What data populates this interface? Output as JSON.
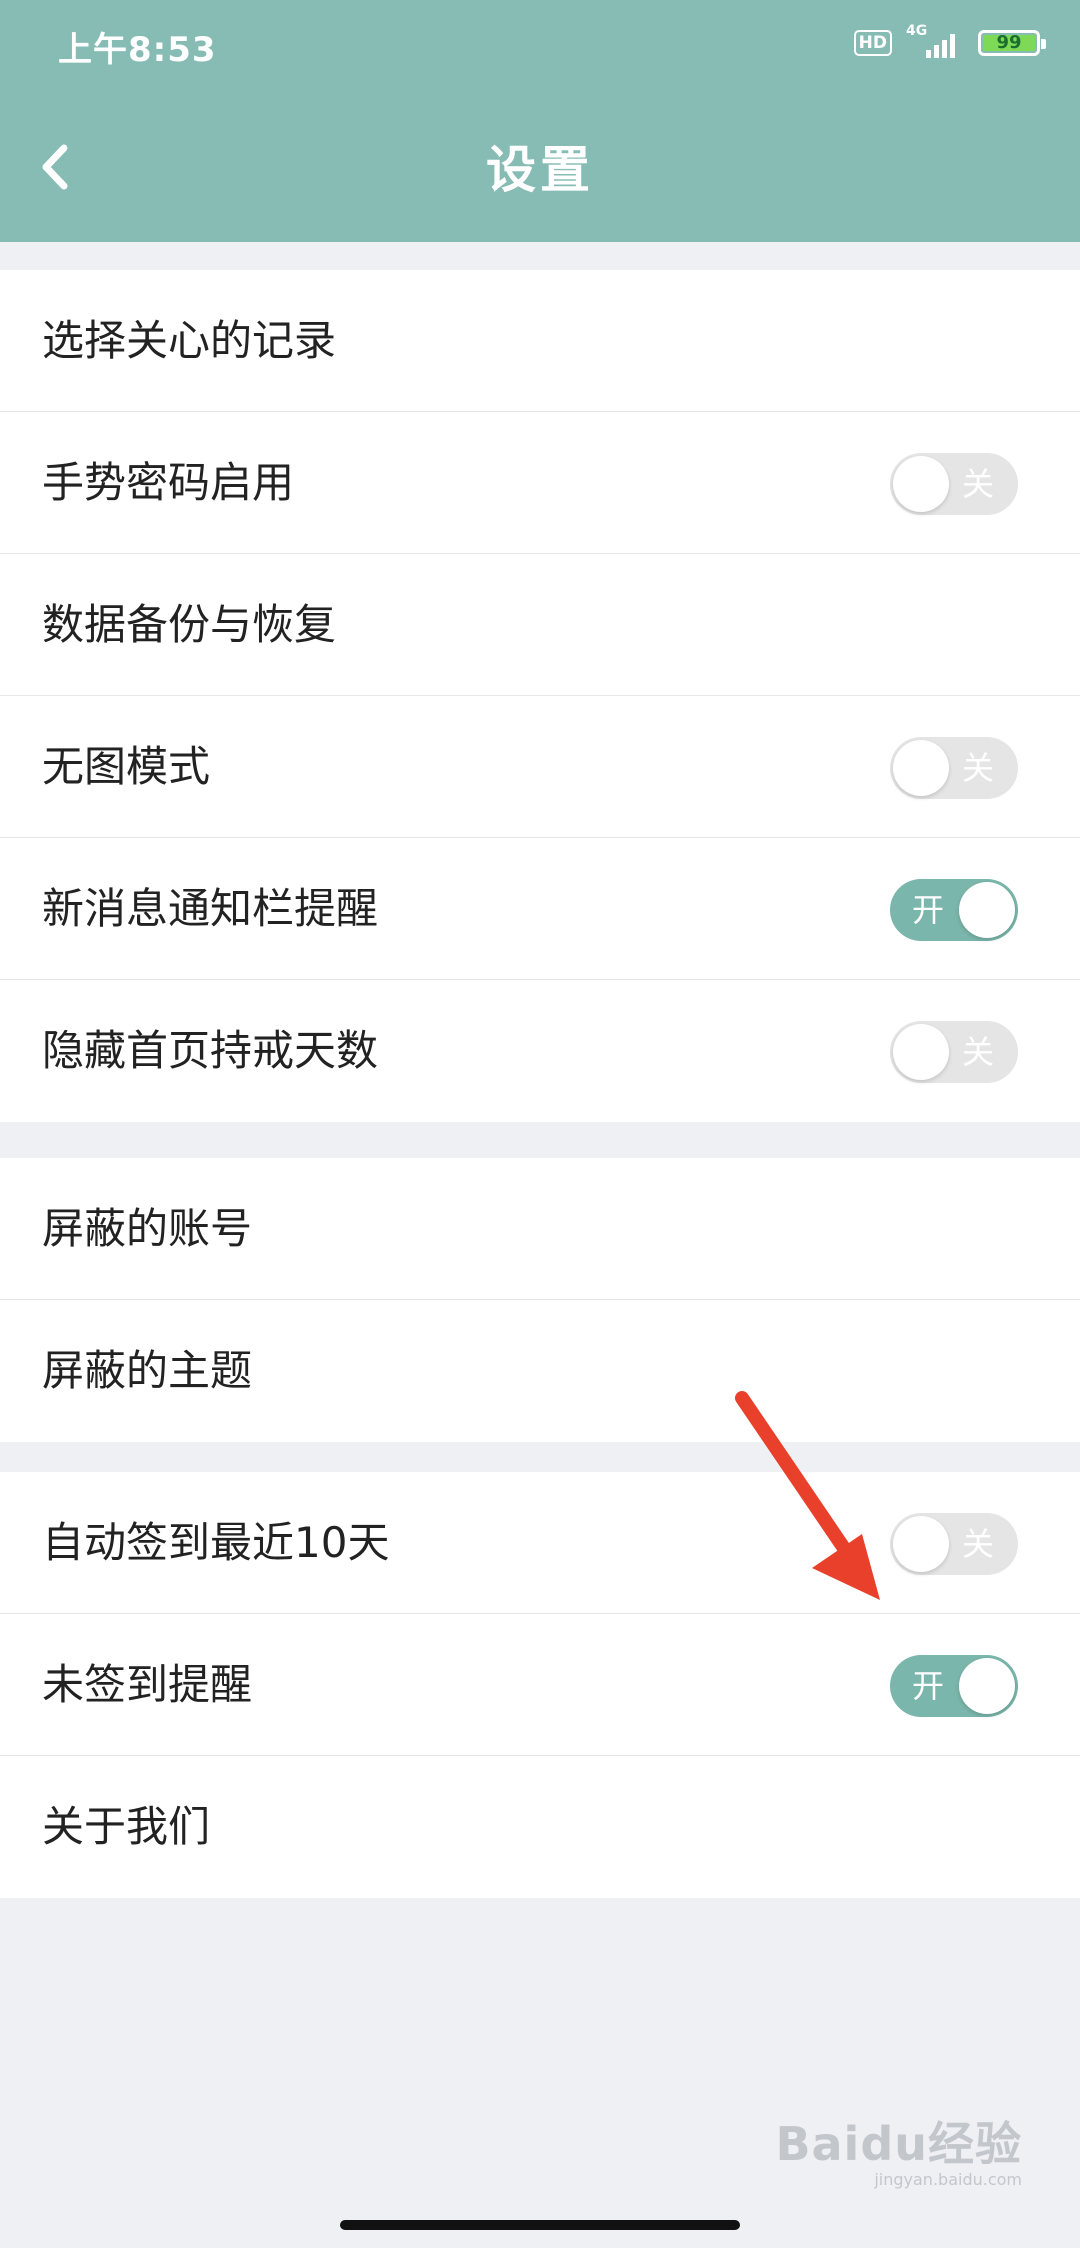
{
  "status_bar": {
    "time": "上午8:53",
    "hd": "HD",
    "network": "4G",
    "battery": "99"
  },
  "header": {
    "title": "设置"
  },
  "groups": [
    {
      "items": [
        {
          "label": "选择关心的记录"
        },
        {
          "label": "手势密码启用",
          "toggle": {
            "state": "off",
            "text": "关"
          }
        },
        {
          "label": "数据备份与恢复"
        },
        {
          "label": "无图模式",
          "toggle": {
            "state": "off",
            "text": "关"
          }
        },
        {
          "label": "新消息通知栏提醒",
          "toggle": {
            "state": "on",
            "text": "开"
          }
        },
        {
          "label": "隐藏首页持戒天数",
          "toggle": {
            "state": "off",
            "text": "关"
          }
        }
      ]
    },
    {
      "items": [
        {
          "label": "屏蔽的账号"
        },
        {
          "label": "屏蔽的主题"
        }
      ]
    },
    {
      "items": [
        {
          "label": "自动签到最近10天",
          "toggle": {
            "state": "off",
            "text": "关"
          }
        },
        {
          "label": "未签到提醒",
          "toggle": {
            "state": "on",
            "text": "开"
          }
        },
        {
          "label": "关于我们"
        }
      ]
    }
  ],
  "watermark": {
    "brand": "Baidu经验",
    "url": "jingyan.baidu.com"
  },
  "colors": {
    "header": "#86bcb4",
    "toggle_on": "#7ab6ab",
    "toggle_off": "#e5e5e5",
    "arrow": "#e8402a"
  }
}
